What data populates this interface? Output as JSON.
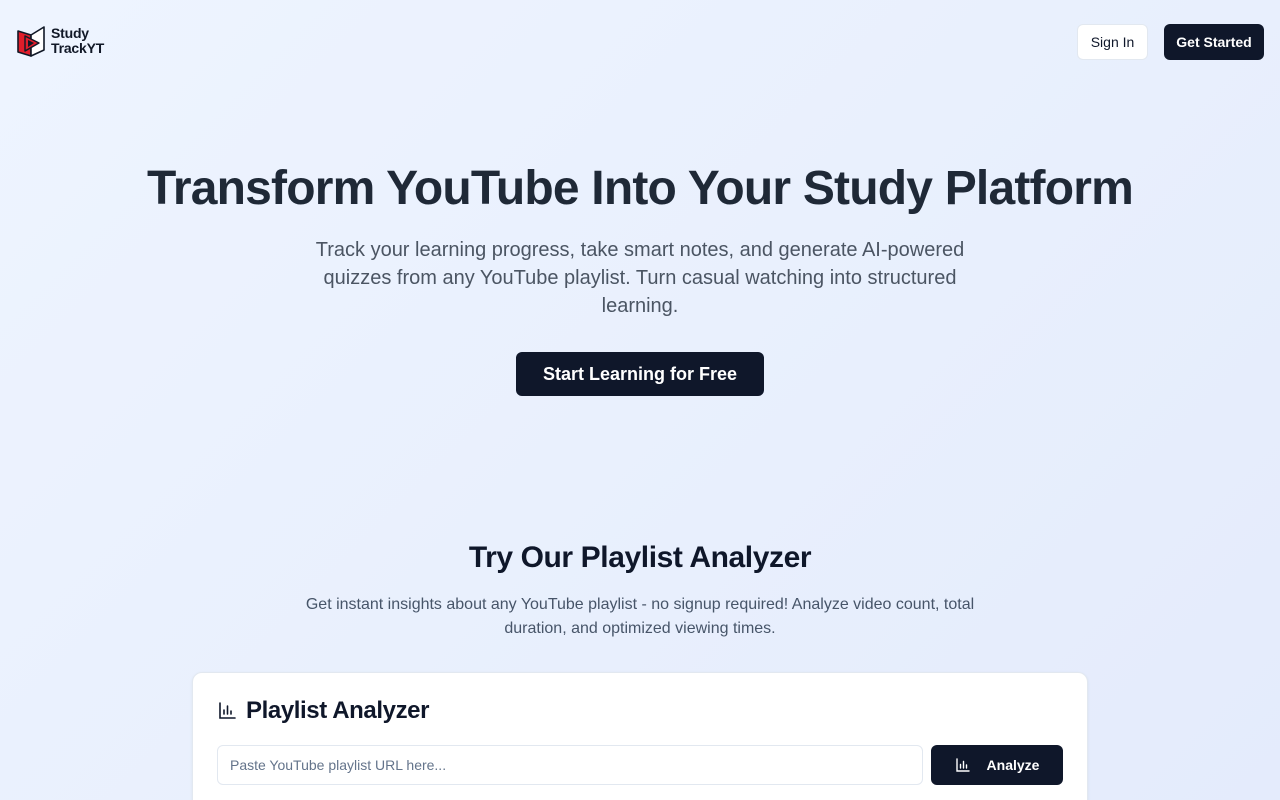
{
  "brand": {
    "line1": "Study",
    "line2": "TrackYT",
    "logo_icon": "book-play-icon",
    "colors": {
      "red": "#e11d2a",
      "dark": "#111827"
    }
  },
  "nav": {
    "sign_in": "Sign In",
    "get_started": "Get Started"
  },
  "hero": {
    "title": "Transform YouTube Into Your Study Platform",
    "subtitle": "Track your learning progress, take smart notes, and generate AI-powered quizzes from any YouTube playlist. Turn casual watching into structured learning.",
    "cta": "Start Learning for Free"
  },
  "analyzer_section": {
    "title": "Try Our Playlist Analyzer",
    "subtitle": "Get instant insights about any YouTube playlist - no signup required! Analyze video count, total duration, and optimized viewing times."
  },
  "analyzer_card": {
    "icon": "bar-chart-icon",
    "title": "Playlist Analyzer",
    "input_placeholder": "Paste YouTube playlist URL here...",
    "input_value": "",
    "button_label": "Analyze",
    "button_icon": "bar-chart-icon"
  },
  "theme": {
    "primary": "#0f172a",
    "background": "#eef4ff"
  }
}
